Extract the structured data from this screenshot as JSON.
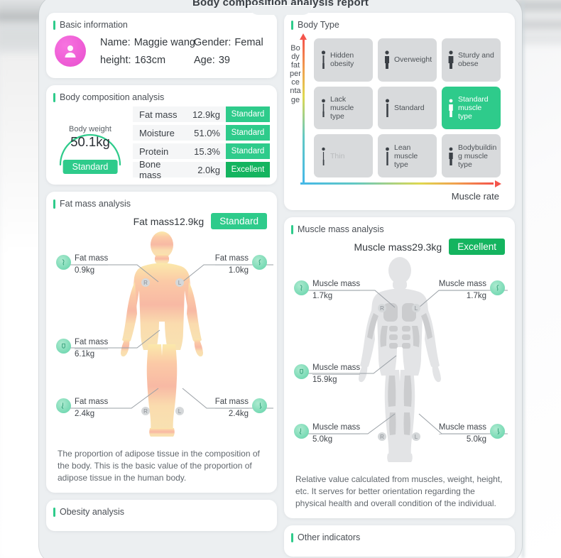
{
  "report": {
    "title": "Body composition analysis report"
  },
  "basic_information": {
    "section_title": "Basic information",
    "avatar_icon": "person-avatar-icon",
    "name_label": "Name:",
    "name_value": "Maggie wang",
    "gender_label": "Gender:",
    "gender_value": "Femal",
    "height_label": "height:",
    "height_value": "163cm",
    "age_label": "Age:",
    "age_value": "39"
  },
  "body_composition": {
    "section_title": "Body composition analysis",
    "gauge": {
      "label": "Body weight",
      "value": "50.1kg",
      "badge": "Standard"
    },
    "rows": [
      {
        "name": "Fat mass",
        "value": "12.9kg",
        "badge": "Standard",
        "level": "standard"
      },
      {
        "name": "Moisture",
        "value": "51.0%",
        "badge": "Standard",
        "level": "standard"
      },
      {
        "name": "Protein",
        "value": "15.3%",
        "badge": "Standard",
        "level": "standard"
      },
      {
        "name": "Bone mass",
        "value": "2.0kg",
        "badge": "Excellent",
        "level": "excellent"
      }
    ]
  },
  "body_type": {
    "section_title": "Body Type",
    "y_axis_label": "Body fat percentage",
    "x_axis_label": "Muscle rate",
    "cells": [
      {
        "label": "Hidden obesity",
        "active": false,
        "figure": "thin-person-icon"
      },
      {
        "label": "Overweight",
        "active": false,
        "figure": "wide-person-icon"
      },
      {
        "label": "Sturdy and obese",
        "active": false,
        "figure": "wide-person-icon"
      },
      {
        "label": "Lack muscle type",
        "active": false,
        "figure": "thin-person-icon"
      },
      {
        "label": "Standard",
        "active": false,
        "figure": "medium-person-icon"
      },
      {
        "label": "Standard muscle type",
        "active": true,
        "figure": "muscular-person-icon"
      },
      {
        "label": "Thin",
        "active": false,
        "figure": "thin-person-icon"
      },
      {
        "label": "Lean muscle type",
        "active": false,
        "figure": "medium-person-icon"
      },
      {
        "label": "Bodybuilding muscle type",
        "active": false,
        "figure": "muscular-person-icon"
      }
    ]
  },
  "fat_mass_analysis": {
    "section_title": "Fat mass analysis",
    "summary": "Fat mass12.9kg",
    "badge": "Standard",
    "badge_level": "standard",
    "figure_icon": "fat-body-figure",
    "tags": [
      {
        "label": "Fat mass",
        "value": "0.9kg",
        "side": "left",
        "part": "right-arm",
        "icon": "arm-icon",
        "mark": "R"
      },
      {
        "label": "Fat mass",
        "value": "1.0kg",
        "side": "right",
        "part": "left-arm",
        "icon": "arm-icon",
        "mark": "L"
      },
      {
        "label": "Fat mass",
        "value": "6.1kg",
        "side": "left",
        "part": "trunk",
        "icon": "trunk-icon"
      },
      {
        "label": "Fat mass",
        "value": "2.4kg",
        "side": "left",
        "part": "right-leg",
        "icon": "leg-icon",
        "mark": "R"
      },
      {
        "label": "Fat mass",
        "value": "2.4kg",
        "side": "right",
        "part": "left-leg",
        "icon": "leg-icon",
        "mark": "L"
      }
    ],
    "description": "The proportion of adipose tissue in the composition of the body. This is the basic value of the proportion of adipose tissue in the human body."
  },
  "muscle_mass_analysis": {
    "section_title": "Muscle mass analysis",
    "summary": "Muscle mass29.3kg",
    "badge": "Excellent",
    "badge_level": "excellent",
    "figure_icon": "muscle-body-figure",
    "tags": [
      {
        "label": "Muscle mass",
        "value": "1.7kg",
        "side": "left",
        "part": "right-arm",
        "icon": "arm-icon",
        "mark": "R"
      },
      {
        "label": "Muscle mass",
        "value": "1.7kg",
        "side": "right",
        "part": "left-arm",
        "icon": "arm-icon",
        "mark": "L"
      },
      {
        "label": "Muscle mass",
        "value": "15.9kg",
        "side": "left",
        "part": "trunk",
        "icon": "trunk-icon"
      },
      {
        "label": "Muscle mass",
        "value": "5.0kg",
        "side": "left",
        "part": "right-leg",
        "icon": "leg-icon",
        "mark": "R"
      },
      {
        "label": "Muscle mass",
        "value": "5.0kg",
        "side": "right",
        "part": "left-leg",
        "icon": "leg-icon",
        "mark": "L"
      }
    ],
    "description": "Relative value calculated from muscles, weight, height, etc. It serves for better orientation regarding the physical health and overall condition of the individual."
  },
  "obesity_analysis": {
    "section_title": "Obesity analysis"
  },
  "other_indicators": {
    "section_title": "Other indicators"
  },
  "colors": {
    "accent_green": "#2ecb8b",
    "excellent_green": "#14b45f",
    "avatar_pink": "#ef5ed6",
    "cell_gray": "#d8dadc",
    "axis_hot": "#f4544b",
    "axis_cool": "#45b8e8"
  }
}
